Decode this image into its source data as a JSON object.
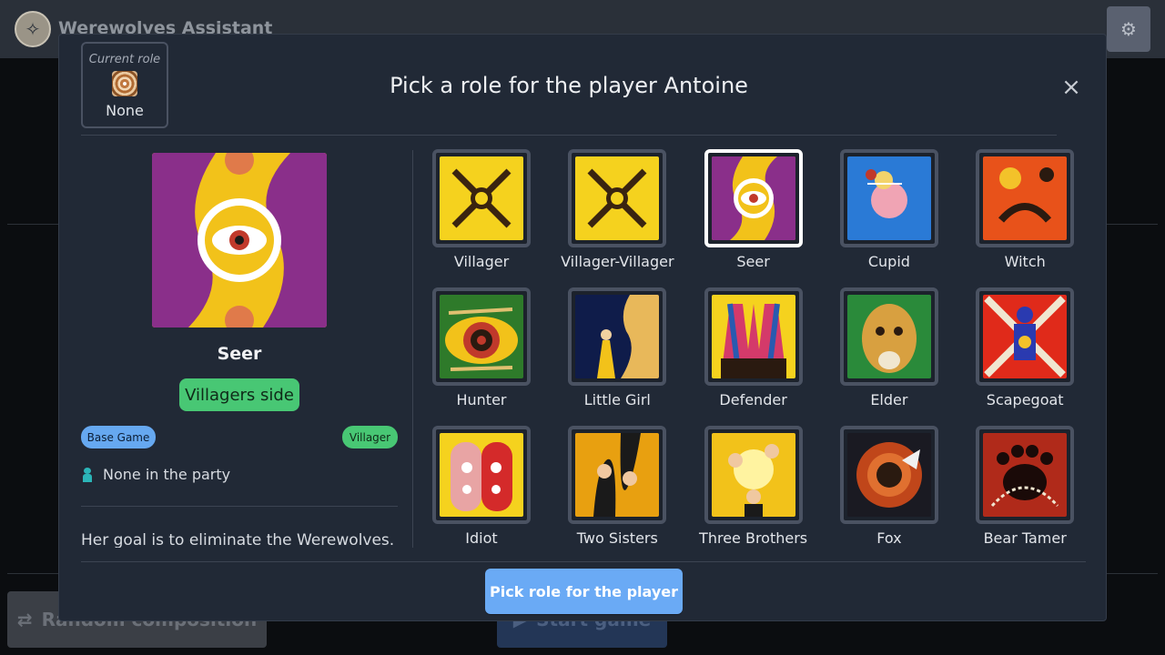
{
  "app": {
    "title": "Werewolves Assistant",
    "logo_icon": "wolf-howl-icon",
    "settings_icon": "gear-icon"
  },
  "background": {
    "random_button_label": "Random composition",
    "start_button_label": "Start game"
  },
  "modal": {
    "title": "Pick a role for the player Antoine",
    "current_role_label": "Current role",
    "current_role_value": "None",
    "close_icon": "close-icon",
    "selected_role": {
      "name": "Seer",
      "side": "Villagers side",
      "tags": [
        "Base Game",
        "Villager"
      ],
      "party": "None in the party",
      "description": "Her goal is to eliminate the Werewolves."
    },
    "roles": [
      {
        "label": "Villager",
        "selected": false
      },
      {
        "label": "Villager-Villager",
        "selected": false
      },
      {
        "label": "Seer",
        "selected": true
      },
      {
        "label": "Cupid",
        "selected": false
      },
      {
        "label": "Witch",
        "selected": false
      },
      {
        "label": "Hunter",
        "selected": false
      },
      {
        "label": "Little Girl",
        "selected": false
      },
      {
        "label": "Defender",
        "selected": false
      },
      {
        "label": "Elder",
        "selected": false
      },
      {
        "label": "Scapegoat",
        "selected": false
      },
      {
        "label": "Idiot",
        "selected": false
      },
      {
        "label": "Two Sisters",
        "selected": false
      },
      {
        "label": "Three Brothers",
        "selected": false
      },
      {
        "label": "Fox",
        "selected": false
      },
      {
        "label": "Bear Tamer",
        "selected": false
      }
    ],
    "pick_button_label": "Pick role for the player"
  },
  "colors": {
    "modal_bg": "#212936",
    "accent_blue": "#6aaaf5",
    "villager_green": "#48c774",
    "base_game_blue": "#66a8f0"
  }
}
